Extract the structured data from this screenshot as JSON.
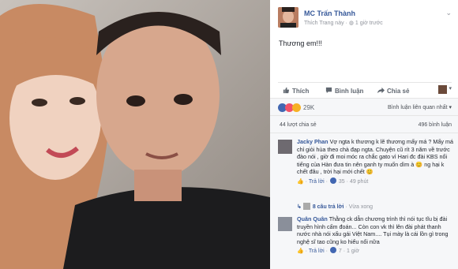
{
  "post": {
    "author": "MC Trấn Thành",
    "sub_link": "Thích Trang này",
    "sub_sep": "·",
    "time": "1 giờ trước",
    "text": "Thương em!!!"
  },
  "actions": {
    "like": "Thích",
    "comment": "Bình luận",
    "share": "Chia sẻ"
  },
  "reactions": {
    "count": "29K",
    "sort": "Bình luận liên quan nhất"
  },
  "counts": {
    "shares": "44 lượt chia sẻ",
    "comments": "496 bình luận"
  },
  "comments": [
    {
      "author": "Jacky Phan",
      "text": "Vợ ngta k thương k lẽ thương mấy má ? Mấy má chỉ giỏi hùa theo chà đạp ngta. Chuyện cũ rít 3 năm về trước đào nói , giờ đi moi móc ra chắc gato vì Hari đc đài KBS nổi tiếng của Hàn đưa tin nên ganh ty muốn dìm à 😊 ng hại k chết đâu , trời hại mới chết 😊",
      "reply": "Trả lời",
      "reactions": "35",
      "time": "49 phút",
      "replies_label": "8 câu trả lời",
      "replies_sep": "·",
      "replies_time": "Vừa xong"
    },
    {
      "author": "Quân Quân",
      "text": "Thằng ck dẫn chương trình thì nói tục tĩu bị đài truyền hình cấm đoán... Còn con vk thì lên đài phát thanh nước nhà nói xấu gái Việt Nam.... Tụi mày là cái lồn gì trong nghệ sĩ tao cũng ko hiểu nổi nữa",
      "reply": "Trả lời",
      "reactions": "7",
      "time": "1 giờ"
    }
  ],
  "colors": {
    "link": "#365899",
    "like": "#4267b2",
    "love": "#f25268",
    "haha": "#f7b125"
  }
}
